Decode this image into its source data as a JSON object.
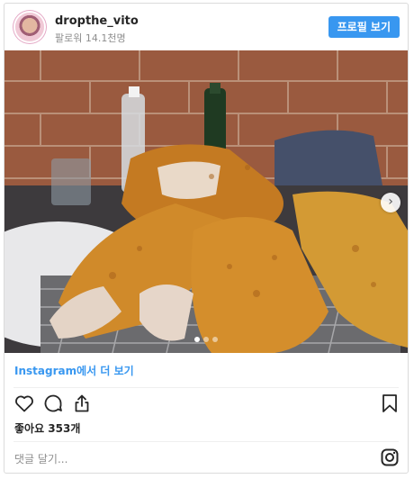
{
  "header": {
    "username": "dropthe_vito",
    "followers": "팔로워 14.1천명",
    "profile_button": "프로필 보기"
  },
  "photo": {
    "alt": "fried-chicken-photo",
    "carousel": {
      "dot_count": 3,
      "active_index": 0,
      "next_icon": "chevron-right-icon"
    }
  },
  "actions": {
    "view_on_instagram": "Instagram에서 더 보기",
    "icons": [
      "heart-icon",
      "comment-icon",
      "share-icon",
      "bookmark-icon"
    ]
  },
  "likes": "좋아요 353개",
  "comment": {
    "placeholder": "댓글 달기..."
  },
  "footer": {
    "icon": "instagram-logo-icon"
  },
  "colors": {
    "accent": "#3897f0",
    "muted": "#8e8e8e",
    "border": "#dbdbdb"
  }
}
